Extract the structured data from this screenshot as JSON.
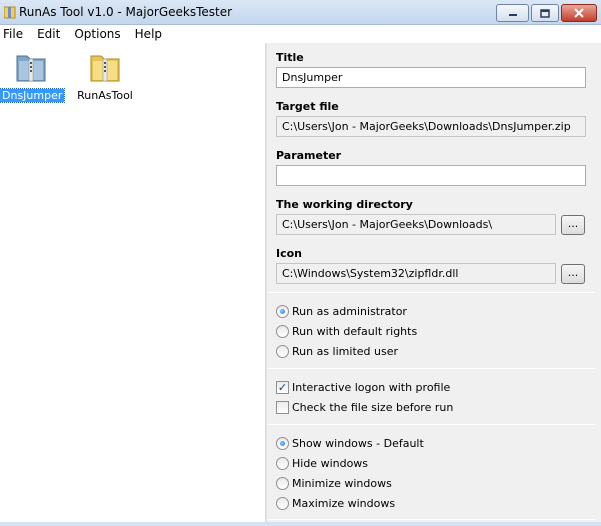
{
  "window": {
    "title": "RunAs Tool v1.0 - MajorGeeksTester",
    "icon": "folder-zip-icon"
  },
  "menu": [
    "File",
    "Edit",
    "Options",
    "Help"
  ],
  "files": [
    {
      "label": "DnsJumper",
      "selected": true,
      "icon": "zip-folder-icon"
    },
    {
      "label": "RunAsTool",
      "selected": false,
      "icon": "zip-folder-icon"
    }
  ],
  "form": {
    "title_label": "Title",
    "title_value": "DnsJumper",
    "target_label": "Target file",
    "target_value": "C:\\Users\\Jon - MajorGeeks\\Downloads\\DnsJumper.zip",
    "parameter_label": "Parameter",
    "parameter_value": "",
    "workdir_label": "The working directory",
    "workdir_value": "C:\\Users\\Jon - MajorGeeks\\Downloads\\",
    "icon_label": "Icon",
    "icon_value": "C:\\Windows\\System32\\zipfldr.dll",
    "browse_label": "..."
  },
  "run_as": {
    "options": [
      "Run as administrator",
      "Run with default rights",
      "Run as limited user"
    ],
    "selected": 0
  },
  "checks": [
    {
      "label": "Interactive logon with profile",
      "checked": true
    },
    {
      "label": "Check the file size before run",
      "checked": false
    }
  ],
  "window_mode": {
    "options": [
      "Show windows - Default",
      "Hide windows",
      "Minimize windows",
      "Maximize windows"
    ],
    "selected": 0
  },
  "colors": {
    "selection": "#3399ff",
    "panel": "#f0f0f0",
    "close_button": "#c43d2c"
  }
}
